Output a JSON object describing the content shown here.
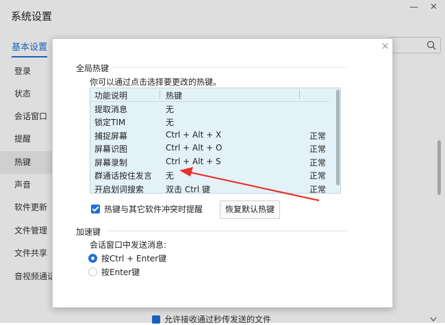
{
  "window": {
    "title": "系统设置",
    "controls": {
      "minimize": "—",
      "close": "✕"
    }
  },
  "tabs": {
    "basic": "基本设置"
  },
  "search": {
    "placeholder": ""
  },
  "sidebar": {
    "items": [
      {
        "label": "登录"
      },
      {
        "label": "状态"
      },
      {
        "label": "会话窗口"
      },
      {
        "label": "提醒"
      },
      {
        "label": "热键"
      },
      {
        "label": "声音"
      },
      {
        "label": "软件更新"
      },
      {
        "label": "文件管理"
      },
      {
        "label": "文件共享"
      },
      {
        "label": "音视频通话"
      }
    ]
  },
  "background_footer": {
    "checkbox_label": "允许接收通过秒传发送的文件"
  },
  "dialog": {
    "close": "×",
    "hotkey_section_title": "全局热键",
    "hint": "你可以通过点击选择要更改的热键。",
    "table": {
      "columns": [
        "功能说明",
        "热键",
        ""
      ],
      "rows": [
        {
          "desc": "提取消息",
          "key": "无",
          "status": ""
        },
        {
          "desc": "锁定TIM",
          "key": "无",
          "status": ""
        },
        {
          "desc": "捕捉屏幕",
          "key": "Ctrl + Alt + X",
          "status": "正常"
        },
        {
          "desc": "屏幕识图",
          "key": "Ctrl + Alt + O",
          "status": "正常"
        },
        {
          "desc": "屏幕录制",
          "key": "Ctrl + Alt + S",
          "status": "正常"
        },
        {
          "desc": "群通话按住发言",
          "key": "无",
          "status": "正常"
        },
        {
          "desc": "开启划词搜索",
          "key": "双击 Ctrl 键",
          "status": "正常"
        }
      ]
    },
    "conflict_checkbox_label": "热键与其它软件冲突时提醒",
    "restore_button": "恢复默认热键",
    "accel_section_title": "加速键",
    "send_label": "会话窗口中发送消息:",
    "radio_ctrl_enter": "按Ctrl + Enter键",
    "radio_enter": "按Enter键"
  },
  "icons": {
    "search": "search-icon",
    "check": "check-icon",
    "arrow": "red-arrow-annotation"
  },
  "colors": {
    "accent": "#1e6fd6",
    "table_bg": "#e3f2f8",
    "annotation_arrow": "#e8322c"
  }
}
